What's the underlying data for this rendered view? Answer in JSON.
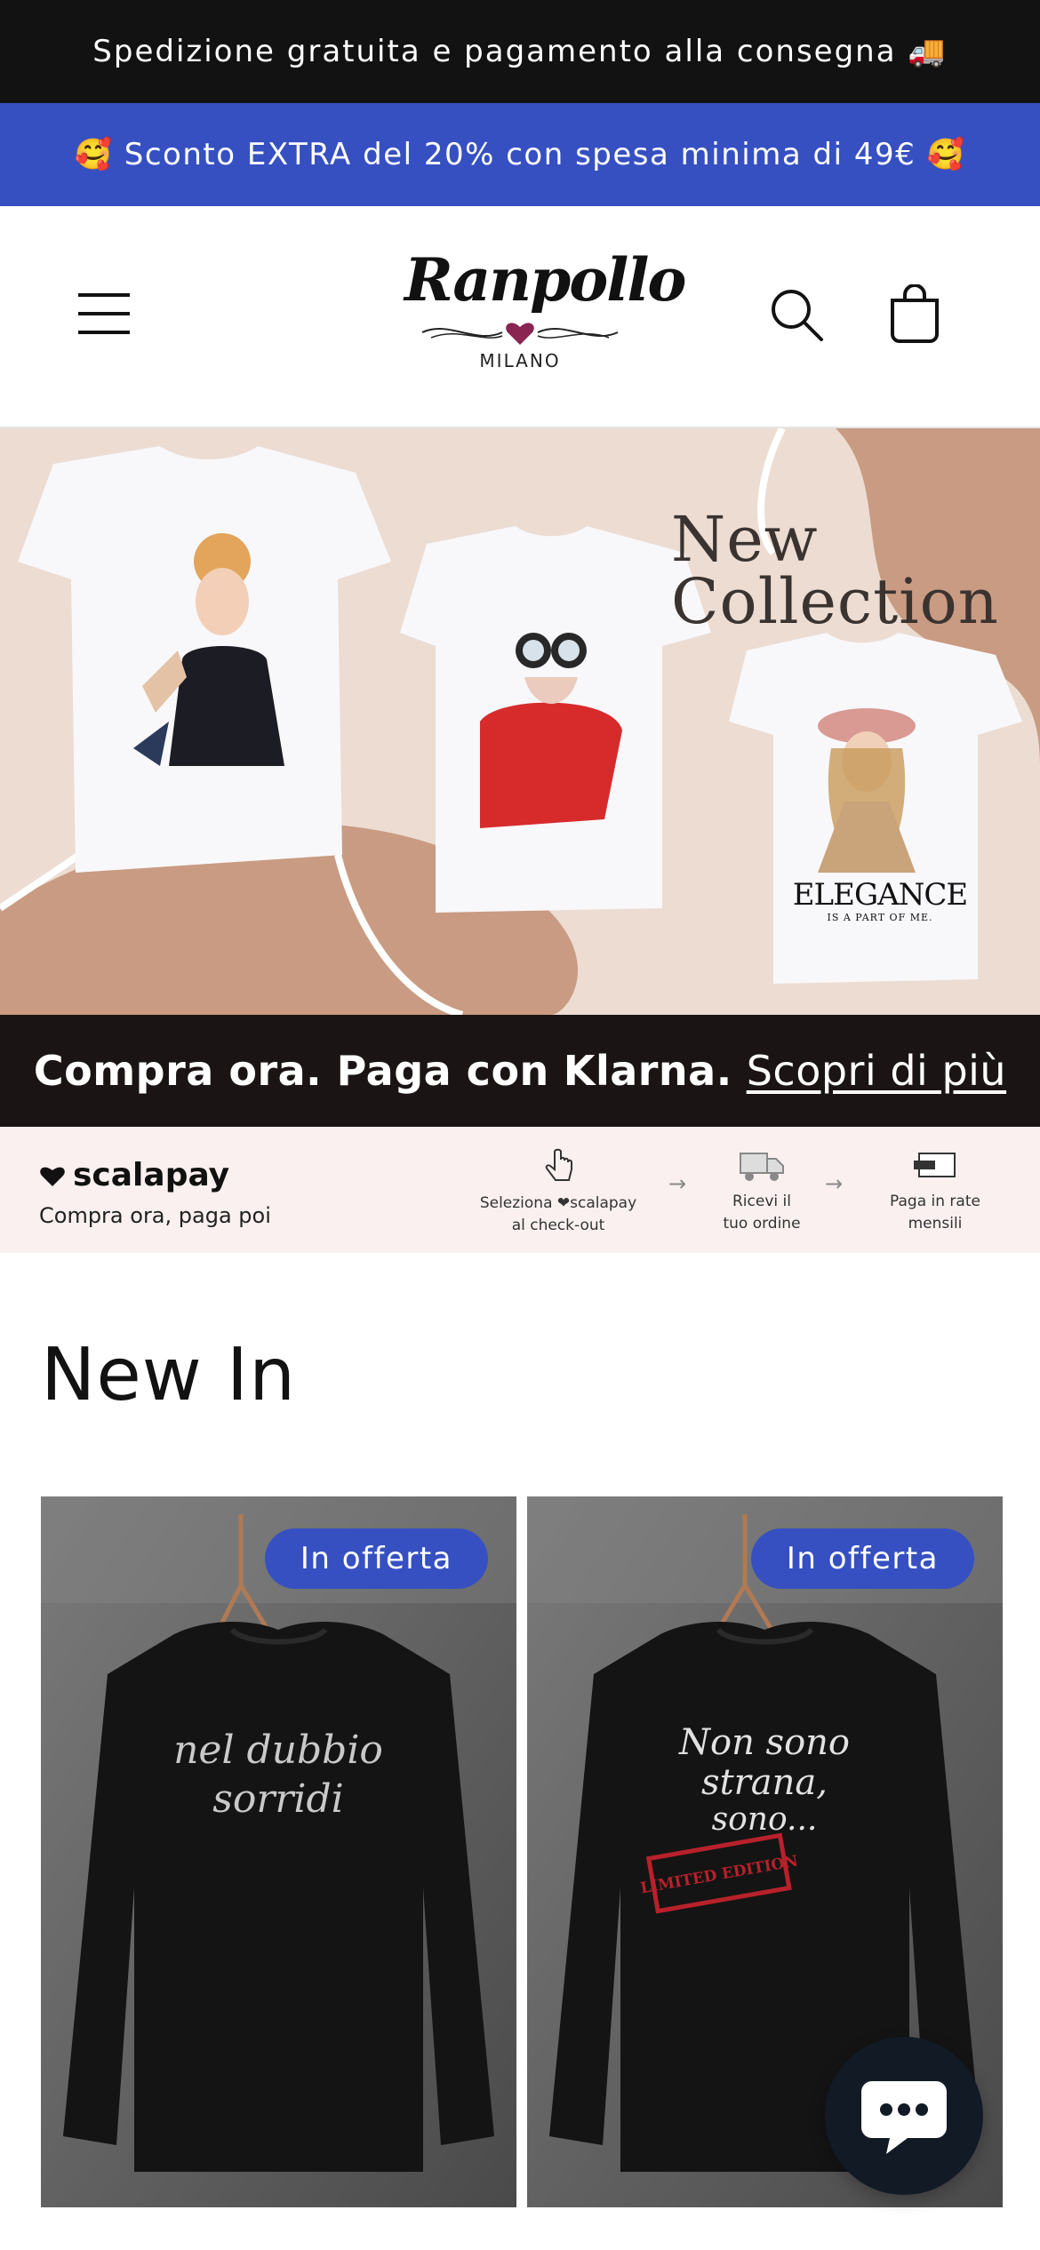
{
  "announcement": {
    "shipping_text": "Spedizione gratuita e pagamento alla consegna 🚚",
    "promo_text": "🥰 Sconto EXTRA del 20% con spesa minima di 49€ 🥰"
  },
  "header": {
    "logo_name": "Ranpollo",
    "logo_sub": "MILANO"
  },
  "hero": {
    "title_line1": "New",
    "title_line2": "Collection",
    "shirt_caption": "ELEGANCE",
    "shirt_caption_sub": "IS A PART OF ME."
  },
  "klarna": {
    "text": "Compra ora. Paga con",
    "brand": "Klarna.",
    "link": "Scopri di più"
  },
  "scalapay": {
    "brand": "scalapay",
    "tagline": "Compra ora, paga poi",
    "steps": [
      {
        "line1": "Seleziona ❤scalapay",
        "line2": "al check-out"
      },
      {
        "line1": "Ricevi il",
        "line2": "tuo ordine"
      },
      {
        "line1": "Paga in rate",
        "line2": "mensili"
      }
    ]
  },
  "new_in": {
    "title": "New In",
    "products": [
      {
        "badge": "In offerta",
        "print_line1": "nel dubbio",
        "print_line2": "sorridi"
      },
      {
        "badge": "In offerta",
        "print_line1": "Non sono",
        "print_line2": "strana,",
        "print_line3": "sono...",
        "stamp": "LIMITED EDITION"
      }
    ]
  },
  "colors": {
    "announcement_bg": "#121212",
    "promo_bg": "#3650c2",
    "badge_bg": "#3650c2",
    "klarna_bg": "#1a1514",
    "scalapay_bg": "#faf0f0",
    "hero_bg": "#ecdcd2",
    "hero_accent": "#c99b82"
  },
  "icons": [
    "menu-icon",
    "search-icon",
    "cart-icon",
    "chat-icon",
    "truck-icon",
    "hand-pointer-icon",
    "heart-icon"
  ]
}
